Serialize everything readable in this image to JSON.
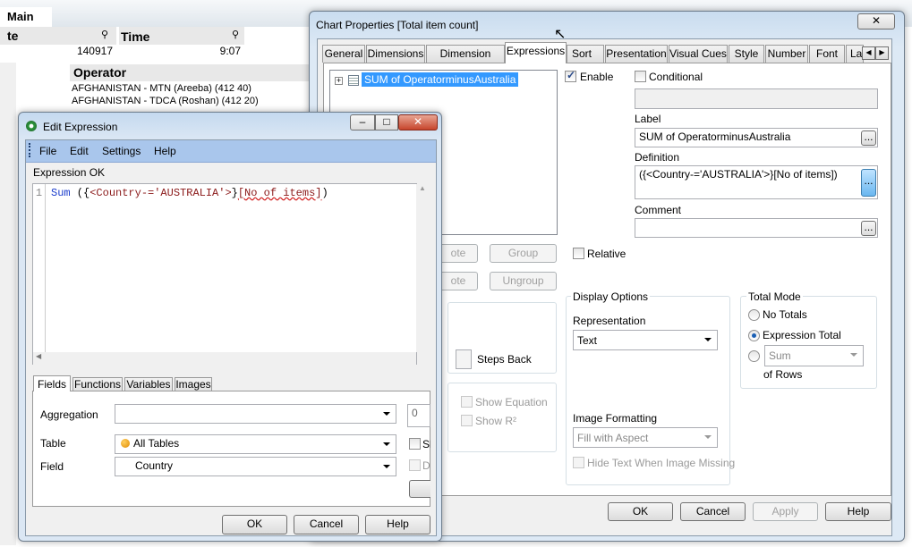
{
  "background": {
    "sheet_tab": "Main",
    "date_box": {
      "title": "te",
      "value": "140917"
    },
    "time_box": {
      "title": "Time",
      "value": "9:07"
    },
    "operator_box": {
      "title": "Operator",
      "items": [
        "AFGHANISTAN - MTN (Areeba) (412 40)",
        "AFGHANISTAN - TDCA (Roshan) (412 20)"
      ]
    }
  },
  "chart_properties": {
    "title": "Chart Properties [Total item count]",
    "tabs": [
      "General",
      "Dimensions",
      "Dimension Limits",
      "Expressions",
      "Sort",
      "Presentation",
      "Visual Cues",
      "Style",
      "Number",
      "Font",
      "La"
    ],
    "active_tab": "Expressions",
    "expression_tree": [
      "SUM of OperatorminusAustralia"
    ],
    "buttons": {
      "promote": "ote",
      "group": "Group",
      "demote": "ote",
      "ungroup": "Ungroup"
    },
    "enable_label": "Enable",
    "enable_checked": true,
    "conditional_label": "Conditional",
    "conditional_checked": false,
    "label_caption": "Label",
    "label_value": "SUM of OperatorminusAustralia",
    "definition_caption": "Definition",
    "definition_value": "({<Country-='AUSTRALIA'>}[No of items])",
    "comment_caption": "Comment",
    "comment_value": "",
    "ellipsis": "...",
    "relative_label": "Relative",
    "steps_back_label": "Steps Back",
    "show_equation_label": "Show Equation",
    "show_r2_label": "Show R²",
    "display_options": {
      "title": "Display Options",
      "representation_label": "Representation",
      "representation_value": "Text",
      "image_formatting_label": "Image Formatting",
      "image_formatting_value": "Fill with Aspect",
      "hide_text_label": "Hide Text When Image Missing"
    },
    "total_mode": {
      "title": "Total Mode",
      "no_totals": "No Totals",
      "expression_total": "Expression Total",
      "selected": "Expression Total",
      "sum_value": "Sum",
      "of_rows": "of Rows"
    },
    "footer": {
      "ok": "OK",
      "cancel": "Cancel",
      "apply": "Apply",
      "help": "Help"
    }
  },
  "edit_expression": {
    "title": "Edit Expression",
    "menu": [
      "File",
      "Edit",
      "Settings",
      "Help"
    ],
    "status": "Expression OK",
    "line_number": "1",
    "code": {
      "func": "Sum",
      "open": " ({",
      "set": "<Country-='AUSTRALIA'>",
      "close_set": "}",
      "field": "[No of items]",
      "close": ")"
    },
    "tabs": [
      "Fields",
      "Functions",
      "Variables",
      "Images"
    ],
    "active_tab": "Fields",
    "aggregation_label": "Aggregation",
    "aggregation_value": "",
    "aggregation_number": "0",
    "table_label": "Table",
    "table_value": "All Tables",
    "field_label": "Field",
    "field_value": "Country",
    "side_cb1": "Sh",
    "side_cb2": "Di",
    "footer": {
      "ok": "OK",
      "cancel": "Cancel",
      "help": "Help"
    }
  },
  "colors": {
    "selection": "#3399ff",
    "menubar": "#a9c6ec",
    "keyword": "#1a3ccc",
    "string": "#8b1a1a"
  }
}
